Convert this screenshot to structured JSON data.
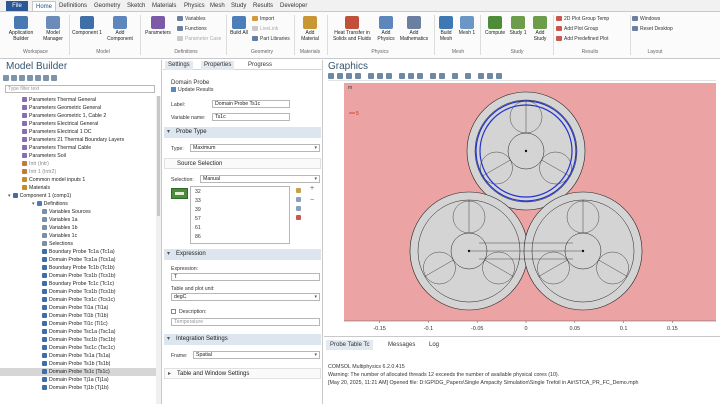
{
  "tabs": [
    "File",
    "Home",
    "Definitions",
    "Geometry",
    "Sketch",
    "Materials",
    "Physics",
    "Mesh",
    "Study",
    "Results",
    "Developer"
  ],
  "ribbon": {
    "workspace": {
      "application_builder": "Application Builder",
      "model_manager": "Model Manager",
      "group": "Workspace"
    },
    "model": {
      "component": "Component 1",
      "add_component": "Add Component",
      "group": "Model"
    },
    "definitions": {
      "parameters": "Parameters",
      "variables": "Variables",
      "functions": "Functions",
      "parameter_case": "Parameter Case",
      "group": "Definitions"
    },
    "geometry": {
      "build_all": "Build All",
      "import": "Import",
      "livelink": "LiveLink",
      "part_libraries": "Part Libraries",
      "group": "Geometry"
    },
    "materials": {
      "add_material": "Add Material",
      "group": "Materials"
    },
    "physics": {
      "heat_transfer": "Heat Transfer in Solids and Fluids",
      "add_physics": "Add Physics",
      "add_mathematics": "Add Mathematics",
      "group": "Physics"
    },
    "mesh": {
      "build_mesh": "Build Mesh",
      "mesh1": "Mesh 1",
      "group": "Mesh"
    },
    "study": {
      "compute": "Compute",
      "study1": "Study 1",
      "add_study": "Add Study",
      "group": "Study"
    },
    "results": {
      "plot_group_2d": "2D Plot Group Temp",
      "add_plot_group": "Add Plot Group",
      "add_predefined": "Add Predefined Plot",
      "group": "Results"
    },
    "layout": {
      "windows": "Windows",
      "reset_desktop": "Reset Desktop",
      "group": "Layout"
    }
  },
  "model_builder": {
    "title": "Model Builder",
    "filter_placeholder": "Type filter text",
    "tree": [
      {
        "text": "Parameters Thermal General",
        "indent": 0,
        "color": "#8a6db0"
      },
      {
        "text": "Parameters Geometric General",
        "indent": 0,
        "color": "#8a6db0"
      },
      {
        "text": "Parameters Geometric 1, Cable 2",
        "indent": 0,
        "color": "#8a6db0"
      },
      {
        "text": "Parameters Electrical General",
        "indent": 0,
        "color": "#8a6db0"
      },
      {
        "text": "Parameters Electrical 1 DC",
        "indent": 0,
        "color": "#8a6db0"
      },
      {
        "text": "Parameters 21 Thermal Boundary Layers",
        "indent": 0,
        "color": "#8a6db0"
      },
      {
        "text": "Parameters Thermal Cable",
        "indent": 0,
        "color": "#8a6db0"
      },
      {
        "text": "Parameters Soil",
        "indent": 0,
        "color": "#8a6db0"
      },
      {
        "text": "Intr (Intr)",
        "indent": 0,
        "color": "#c07a3a",
        "gray": true
      },
      {
        "text": "Intr 1 (Intr2)",
        "indent": 0,
        "color": "#c07a3a",
        "gray": true
      },
      {
        "text": "Common model inputs 1",
        "indent": 0,
        "color": "#c98a2a"
      },
      {
        "text": "Materials",
        "indent": 0,
        "color": "#c98a2a"
      },
      {
        "text": "Component 1 (comp1)",
        "indent": -1,
        "color": "#3d6fa6"
      },
      {
        "text": "Definitions",
        "indent": 1,
        "color": "#4a7db5"
      },
      {
        "text": "Variables Sources",
        "indent": 2,
        "color": "#7b8fa6"
      },
      {
        "text": "Variables 1a",
        "indent": 2,
        "color": "#7b8fa6"
      },
      {
        "text": "Variables 1b",
        "indent": 2,
        "color": "#7b8fa6"
      },
      {
        "text": "Variables 1c",
        "indent": 2,
        "color": "#7b8fa6"
      },
      {
        "text": "Selections",
        "indent": 2,
        "color": "#7b8fa6"
      },
      {
        "text": "Boundary Probe Tc1a (Tc1a)",
        "indent": 2,
        "color": "#3d6fa6"
      },
      {
        "text": "Domain Probe Tcs1a (Tcs1a)",
        "indent": 2,
        "color": "#3d6fa6"
      },
      {
        "text": "Boundary Probe Tc1b (Tc1b)",
        "indent": 2,
        "color": "#3d6fa6"
      },
      {
        "text": "Domain Probe Tcs1b (Tcs1b)",
        "indent": 2,
        "color": "#3d6fa6"
      },
      {
        "text": "Boundary Probe Tc1c (Tc1c)",
        "indent": 2,
        "color": "#3d6fa6"
      },
      {
        "text": "Domain Probe Tcs1b (Tcs1b)",
        "indent": 2,
        "color": "#3d6fa6"
      },
      {
        "text": "Domain Probe Tcs1c (Tcs1c)",
        "indent": 2,
        "color": "#3d6fa6"
      },
      {
        "text": "Domain Probe Ti1a (Ti1a)",
        "indent": 2,
        "color": "#3d6fa6"
      },
      {
        "text": "Domain Probe Ti1b (Ti1b)",
        "indent": 2,
        "color": "#3d6fa6"
      },
      {
        "text": "Domain Probe Ti1c (Ti1c)",
        "indent": 2,
        "color": "#3d6fa6"
      },
      {
        "text": "Domain Probe Tsc1a (Tsc1a)",
        "indent": 2,
        "color": "#3d6fa6"
      },
      {
        "text": "Domain Probe Tsc1b (Tsc1b)",
        "indent": 2,
        "color": "#3d6fa6"
      },
      {
        "text": "Domain Probe Tsc1c (Tsc1c)",
        "indent": 2,
        "color": "#3d6fa6"
      },
      {
        "text": "Domain Probe Ts1a (Ts1a)",
        "indent": 2,
        "color": "#3d6fa6"
      },
      {
        "text": "Domain Probe Ts1b (Ts1b)",
        "indent": 2,
        "color": "#3d6fa6"
      },
      {
        "text": "Domain Probe Ts1c (Ts1c)",
        "indent": 2,
        "color": "#3d6fa6",
        "selected": true
      },
      {
        "text": "Domain Probe Tj1a (Tj1a)",
        "indent": 2,
        "color": "#3d6fa6"
      },
      {
        "text": "Domain Probe Tj1b (Tj1b)",
        "indent": 2,
        "color": "#3d6fa6"
      }
    ]
  },
  "settings": {
    "tabs": [
      "Settings",
      "Properties",
      "Progress"
    ],
    "header": "Domain Probe",
    "update_results": "Update Results",
    "label_caption": "Label:",
    "label_value": "Domain Probe Ts1c",
    "varname_caption": "Variable name:",
    "varname_value": "Ts1c",
    "probe_type_section": "Probe Type",
    "type_caption": "Type:",
    "type_value": "Maximum",
    "source_selection_section": "Source Selection",
    "selection_caption": "Selection:",
    "selection_value": "Manual",
    "selection_items": [
      "32",
      "33",
      "39",
      "57",
      "61",
      "86"
    ],
    "expression_section": "Expression",
    "expression_caption": "Expression:",
    "expression_value": "T",
    "unit_caption": "Table and plot unit:",
    "unit_value": "degC",
    "description_caption": "Description:",
    "description_placeholder": "Temperature",
    "integration_section": "Integration Settings",
    "frame_caption": "Frame:",
    "frame_value": "Spatial",
    "table_window_section": "Table and Window Settings"
  },
  "graphics": {
    "title": "Graphics",
    "x_tick_labels": [
      "-0.15",
      "-0.1",
      "-0.05",
      "0",
      "0.05",
      "0.1",
      "0.15"
    ],
    "axis_unit": "m",
    "bg_color": "#eba3a3",
    "cable_fill": "#d4d4d4",
    "cable_stroke": "#222222",
    "highlight_stroke": "#2233cc",
    "marker_label": "5"
  },
  "messages": {
    "tabs": [
      "Probe Table Tc",
      "Messages",
      "Log"
    ],
    "lines": [
      "COMSOL Multiphysics 6.2.0.415",
      "Warning: The number of allocated threads 12 exceeds the number of available physical cores (10).",
      "[May 20, 2025, 11:21 AM] Opened file: D:\\GP\\DG_Papers\\Single Ampacity Simulation\\Single Trefoil in Air\\STCA_PR_FC_Demo.mph"
    ]
  }
}
